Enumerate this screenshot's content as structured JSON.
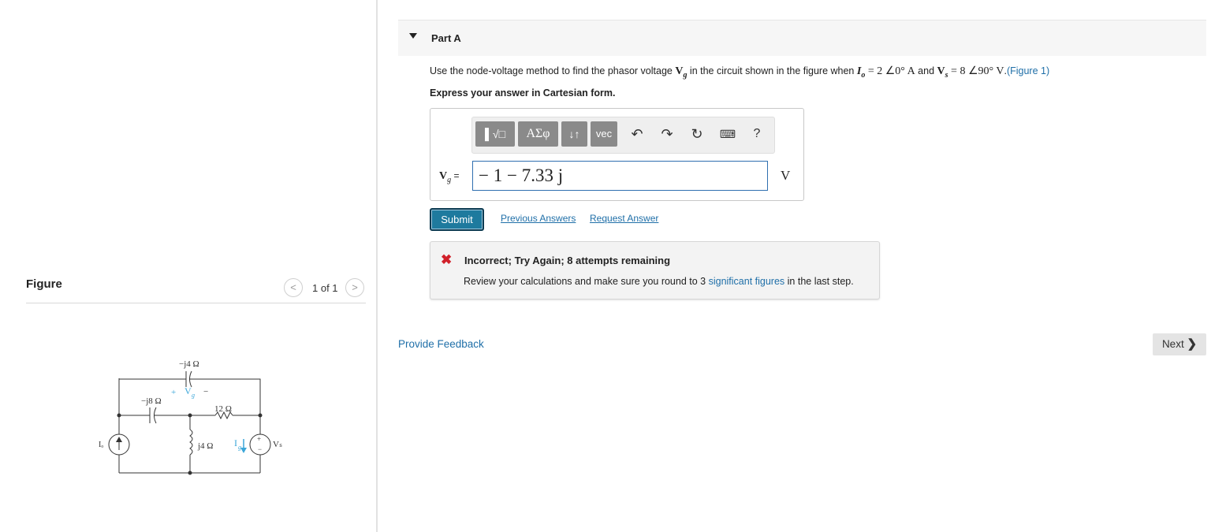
{
  "figure_panel": {
    "title": "Figure",
    "pager_text": "1 of 1",
    "prev_icon": "chevron-left-icon",
    "next_icon": "chevron-right-icon",
    "circuit_labels": {
      "cap_top": "−j4 Ω",
      "cap_left": "−j8 Ω",
      "resistor": "12 Ω",
      "inductor": "j4 Ω",
      "current_source": "Iₒ",
      "voltage_source": "Vₛ",
      "vg_plus": "+",
      "vg_label": "V",
      "vg_sub": "g",
      "vg_minus": "−",
      "ig_label": "I",
      "ig_sub": "g",
      "vs_plus": "+",
      "vs_minus": "−"
    }
  },
  "part": {
    "title": "Part A",
    "caret_icon": "caret-down-icon"
  },
  "question": {
    "text_1": "Use the node-voltage method to find the phasor voltage ",
    "var_vg": "V",
    "var_vg_sub": "g",
    "text_2": " in the circuit shown in the figure when ",
    "var_io": "I",
    "var_io_sub": "o",
    "io_value": " = 2 ∠0° A",
    "text_3": " and ",
    "var_vs": "V",
    "var_vs_sub": "s",
    "vs_value": " = 8 ∠90° V",
    "text_4": ".",
    "figure_link": "(Figure 1)",
    "instruction": "Express your answer in Cartesian form."
  },
  "toolbar": {
    "templates_label": "▌√□",
    "greek_label": "ΑΣφ",
    "arrows_label": "↓↑",
    "vec_label": "vec",
    "undo_icon": "↶",
    "redo_icon": "↷",
    "reset_icon": "↻",
    "keyboard_icon": "⌨",
    "help_label": "?"
  },
  "answer": {
    "label_var": "V",
    "label_sub": "g",
    "label_eq": " =",
    "value": "− 1 − 7.33 j",
    "unit": "V"
  },
  "actions": {
    "submit_label": "Submit",
    "previous_answers": "Previous Answers",
    "request_answer": "Request Answer"
  },
  "feedback": {
    "icon": "✖",
    "title": "Incorrect; Try Again; 8 attempts remaining",
    "msg_1": "Review your calculations and make sure you round to 3 ",
    "msg_link": "significant figures",
    "msg_2": " in the last step.",
    "status_color": "#d1202a"
  },
  "footer": {
    "provide_feedback": "Provide Feedback",
    "next_label": "Next",
    "next_icon": "❯"
  },
  "colors": {
    "link": "#1f6fa8",
    "submit_bg": "#1e7a9e",
    "toolbar_btn": "#8a8a8a",
    "circuit_accent": "#3aa6d8"
  }
}
